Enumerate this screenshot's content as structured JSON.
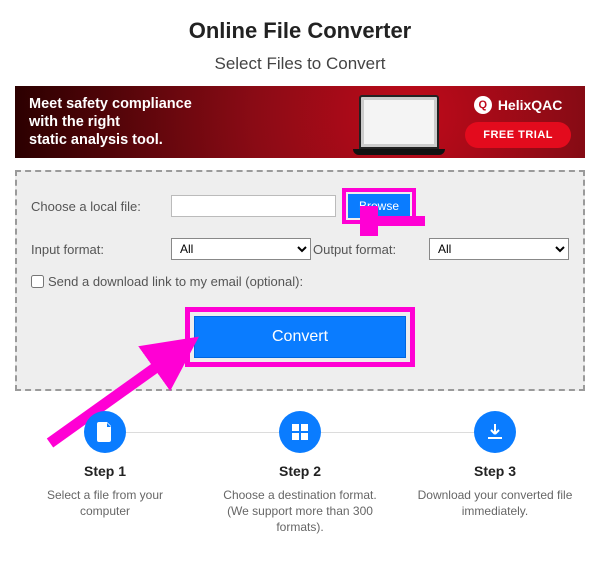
{
  "page": {
    "title": "Online File Converter",
    "subtitle": "Select Files to Convert"
  },
  "ad": {
    "headline": "Meet safety compliance\nwith the right\nstatic analysis tool.",
    "brand": "HelixQAC",
    "cta": "FREE TRIAL"
  },
  "form": {
    "local_file_label": "Choose a local file:",
    "browse_label": "Browse",
    "input_format_label": "Input format:",
    "input_format_value": "All",
    "output_format_label": "Output format:",
    "output_format_value": "All",
    "email_checkbox_label": "Send a download link to my email (optional):",
    "convert_label": "Convert"
  },
  "steps": [
    {
      "title": "Step 1",
      "desc": "Select a file from your computer"
    },
    {
      "title": "Step 2",
      "desc": "Choose a destination format. (We support more than 300 formats)."
    },
    {
      "title": "Step 3",
      "desc": "Download your converted file immediately."
    }
  ]
}
